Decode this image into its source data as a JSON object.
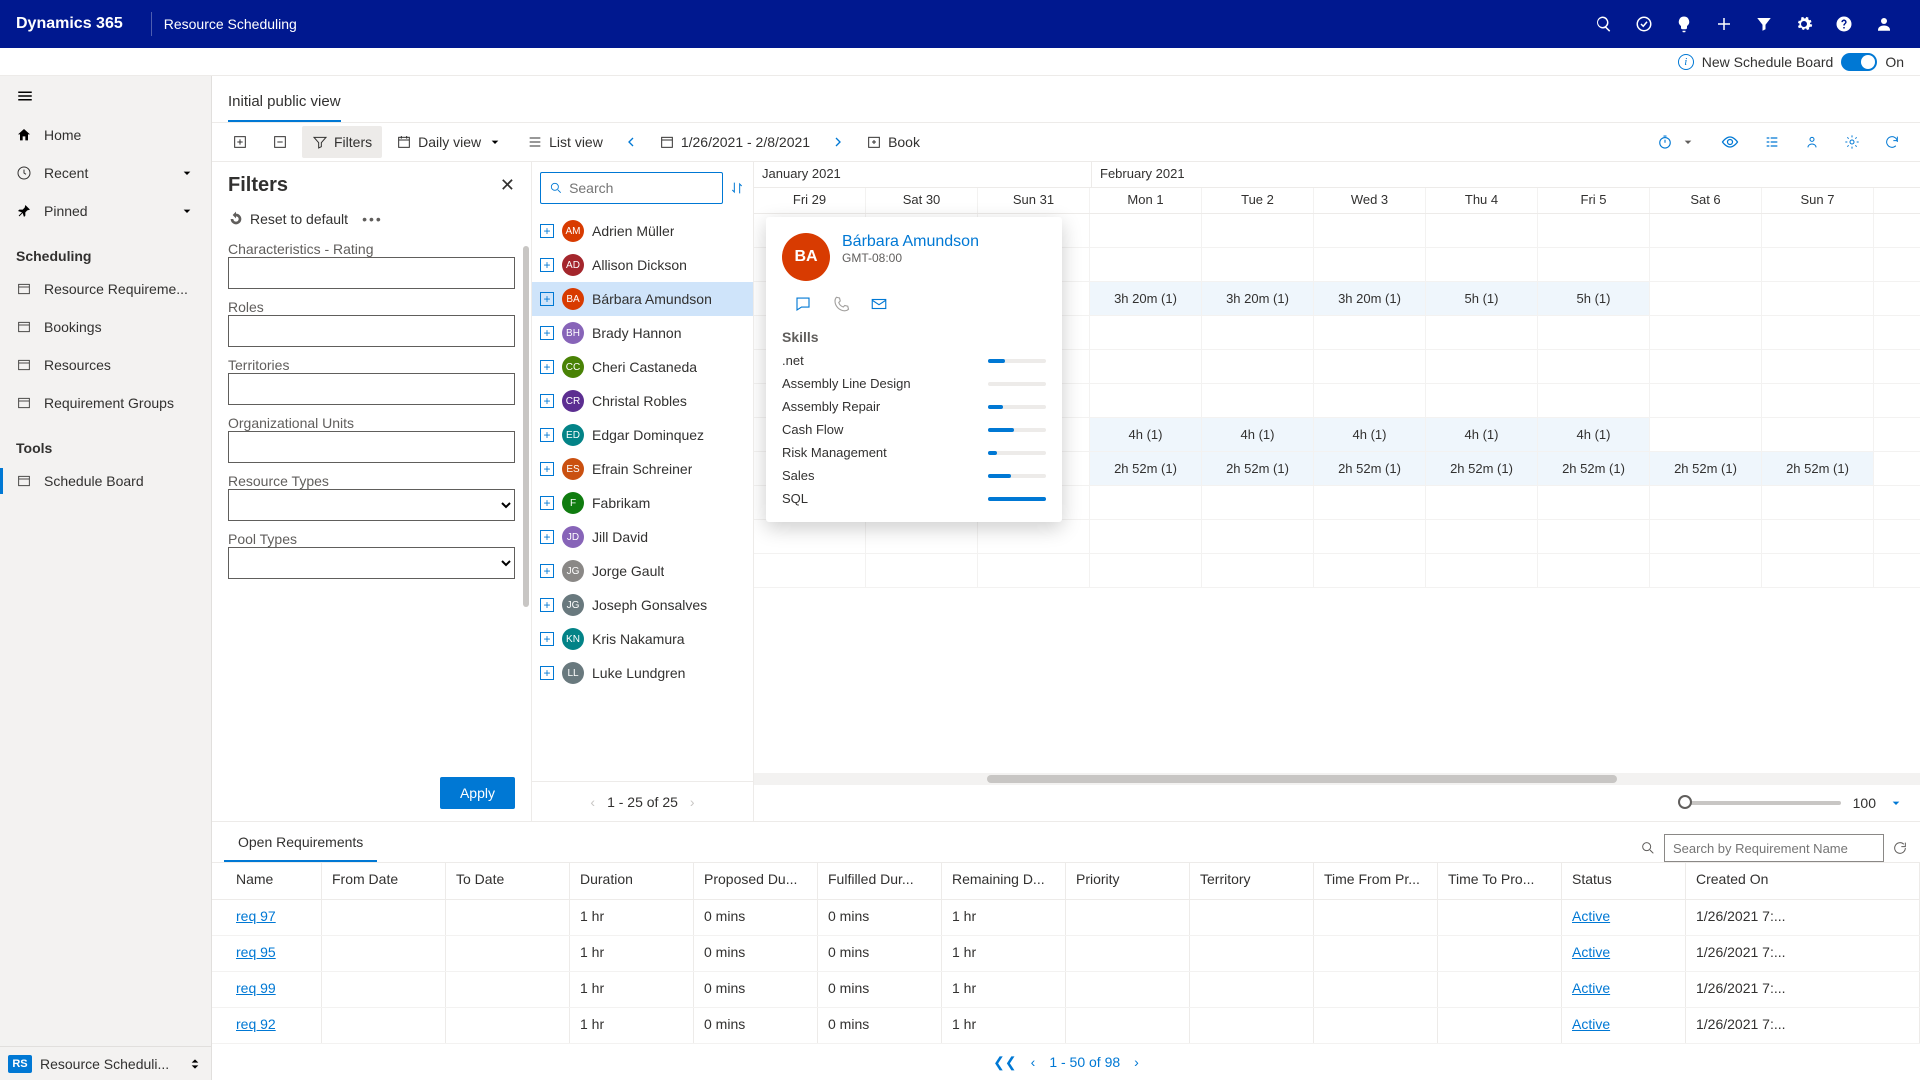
{
  "header": {
    "brand": "Dynamics 365",
    "area": "Resource Scheduling"
  },
  "infobar": {
    "label": "New Schedule Board",
    "state": "On"
  },
  "nav": {
    "top": [
      {
        "label": "Home",
        "icon": "home-icon"
      },
      {
        "label": "Recent",
        "icon": "clock-icon",
        "chev": true
      },
      {
        "label": "Pinned",
        "icon": "pin-icon",
        "chev": true
      }
    ],
    "sections": [
      {
        "title": "Scheduling",
        "items": [
          {
            "label": "Resource Requireme..."
          },
          {
            "label": "Bookings"
          },
          {
            "label": "Resources"
          },
          {
            "label": "Requirement Groups"
          }
        ]
      },
      {
        "title": "Tools",
        "items": [
          {
            "label": "Schedule Board",
            "active": true
          }
        ]
      }
    ],
    "bottom": {
      "badge": "RS",
      "label": "Resource Scheduli..."
    }
  },
  "viewtab": {
    "label": "Initial public view"
  },
  "toolbar": {
    "filters": "Filters",
    "daily": "Daily view",
    "list": "List view",
    "daterange": "1/26/2021 - 2/8/2021",
    "book": "Book"
  },
  "filters": {
    "title": "Filters",
    "reset": "Reset to default",
    "fields": [
      {
        "label": "Characteristics - Rating",
        "type": "text"
      },
      {
        "label": "Roles",
        "type": "text"
      },
      {
        "label": "Territories",
        "type": "text"
      },
      {
        "label": "Organizational Units",
        "type": "text"
      },
      {
        "label": "Resource Types",
        "type": "select"
      },
      {
        "label": "Pool Types",
        "type": "select"
      }
    ],
    "apply": "Apply"
  },
  "reslist": {
    "search_placeholder": "Search",
    "rows": [
      {
        "name": "Adrien Müller",
        "initials": "AM",
        "color": "#d83b01"
      },
      {
        "name": "Allison Dickson",
        "initials": "AD",
        "color": "#a4262c"
      },
      {
        "name": "Bárbara Amundson",
        "initials": "BA",
        "color": "#d83b01",
        "selected": true
      },
      {
        "name": "Brady Hannon",
        "initials": "BH",
        "color": "#8764b8"
      },
      {
        "name": "Cheri Castaneda",
        "initials": "CC",
        "color": "#498205"
      },
      {
        "name": "Christal Robles",
        "initials": "CR",
        "color": "#5c2e91"
      },
      {
        "name": "Edgar Dominquez",
        "initials": "ED",
        "color": "#038387"
      },
      {
        "name": "Efrain Schreiner",
        "initials": "ES",
        "color": "#ca5010"
      },
      {
        "name": "Fabrikam",
        "initials": "F",
        "color": "#107c10"
      },
      {
        "name": "Jill David",
        "initials": "JD",
        "color": "#8764b8"
      },
      {
        "name": "Jorge Gault",
        "initials": "JG",
        "color": "#8a8886"
      },
      {
        "name": "Joseph Gonsalves",
        "initials": "JG",
        "color": "#69797e"
      },
      {
        "name": "Kris Nakamura",
        "initials": "KN",
        "color": "#038387"
      },
      {
        "name": "Luke Lundgren",
        "initials": "LL",
        "color": "#69797e"
      }
    ],
    "pager": "1 - 25 of 25"
  },
  "schedule": {
    "month1": "January 2021",
    "month2": "February 2021",
    "days": [
      "Fri 29",
      "Sat 30",
      "Sun 31",
      "Mon 1",
      "Tue 2",
      "Wed 3",
      "Thu 4",
      "Fri 5",
      "Sat 6",
      "Sun 7"
    ],
    "rows": [
      {
        "cells": [
          "",
          "",
          "",
          "",
          "",
          "",
          "",
          "",
          "",
          ""
        ]
      },
      {
        "cells": [
          "",
          "",
          "",
          "",
          "",
          "",
          "",
          "",
          "",
          ""
        ]
      },
      {
        "cells": [
          "",
          "",
          "",
          "3h 20m (1)",
          "3h 20m (1)",
          "3h 20m (1)",
          "5h (1)",
          "5h (1)",
          "",
          ""
        ],
        "load": [
          false,
          false,
          false,
          true,
          true,
          true,
          true,
          true,
          false,
          false
        ]
      },
      {
        "cells": [
          "",
          "",
          "",
          "",
          "",
          "",
          "",
          "",
          "",
          ""
        ]
      },
      {
        "cells": [
          "",
          "",
          "",
          "",
          "",
          "",
          "",
          "",
          "",
          ""
        ]
      },
      {
        "cells": [
          "",
          "",
          "",
          "",
          "",
          "",
          "",
          "",
          "",
          ""
        ]
      },
      {
        "cells": [
          "",
          "",
          "",
          "4h (1)",
          "4h (1)",
          "4h (1)",
          "4h (1)",
          "4h (1)",
          "",
          ""
        ],
        "load": [
          false,
          false,
          false,
          true,
          true,
          true,
          true,
          true,
          false,
          false
        ]
      },
      {
        "cells": [
          "",
          "",
          "",
          "2h 52m (1)",
          "2h 52m (1)",
          "2h 52m (1)",
          "2h 52m (1)",
          "2h 52m (1)",
          "2h 52m (1)",
          "2h 52m (1)"
        ],
        "load": [
          false,
          false,
          false,
          true,
          true,
          true,
          true,
          true,
          true,
          true
        ]
      },
      {
        "cells": [
          "",
          "",
          "",
          "",
          "",
          "",
          "",
          "",
          "",
          ""
        ]
      },
      {
        "cells": [
          "",
          "",
          "",
          "",
          "",
          "",
          "",
          "",
          "",
          ""
        ]
      },
      {
        "cells": [
          "",
          "",
          "",
          "",
          "",
          "",
          "",
          "",
          "",
          ""
        ]
      }
    ],
    "zoom": "100"
  },
  "hovercard": {
    "initials": "BA",
    "name": "Bárbara Amundson",
    "tz": "GMT-08:00",
    "skills_h": "Skills",
    "skills": [
      {
        "name": ".net",
        "pct": 30
      },
      {
        "name": "Assembly Line Design",
        "pct": 0
      },
      {
        "name": "Assembly Repair",
        "pct": 25
      },
      {
        "name": "Cash Flow",
        "pct": 45
      },
      {
        "name": "Risk Management",
        "pct": 15
      },
      {
        "name": "Sales",
        "pct": 40
      },
      {
        "name": "SQL",
        "pct": 100
      }
    ]
  },
  "reqs": {
    "tab": "Open Requirements",
    "search_placeholder": "Search by Requirement Name",
    "columns": [
      "Name",
      "From Date",
      "To Date",
      "Duration",
      "Proposed Du...",
      "Fulfilled Dur...",
      "Remaining D...",
      "Priority",
      "Territory",
      "Time From Pr...",
      "Time To Pro...",
      "Status",
      "Created On"
    ],
    "rows": [
      {
        "name": "req 97",
        "dur": "1 hr",
        "pd": "0 mins",
        "fd": "0 mins",
        "rd": "1 hr",
        "status": "Active",
        "co": "1/26/2021 7:..."
      },
      {
        "name": "req 95",
        "dur": "1 hr",
        "pd": "0 mins",
        "fd": "0 mins",
        "rd": "1 hr",
        "status": "Active",
        "co": "1/26/2021 7:..."
      },
      {
        "name": "req 99",
        "dur": "1 hr",
        "pd": "0 mins",
        "fd": "0 mins",
        "rd": "1 hr",
        "status": "Active",
        "co": "1/26/2021 7:..."
      },
      {
        "name": "req 92",
        "dur": "1 hr",
        "pd": "0 mins",
        "fd": "0 mins",
        "rd": "1 hr",
        "status": "Active",
        "co": "1/26/2021 7:..."
      }
    ],
    "pager": "1 - 50 of 98"
  }
}
